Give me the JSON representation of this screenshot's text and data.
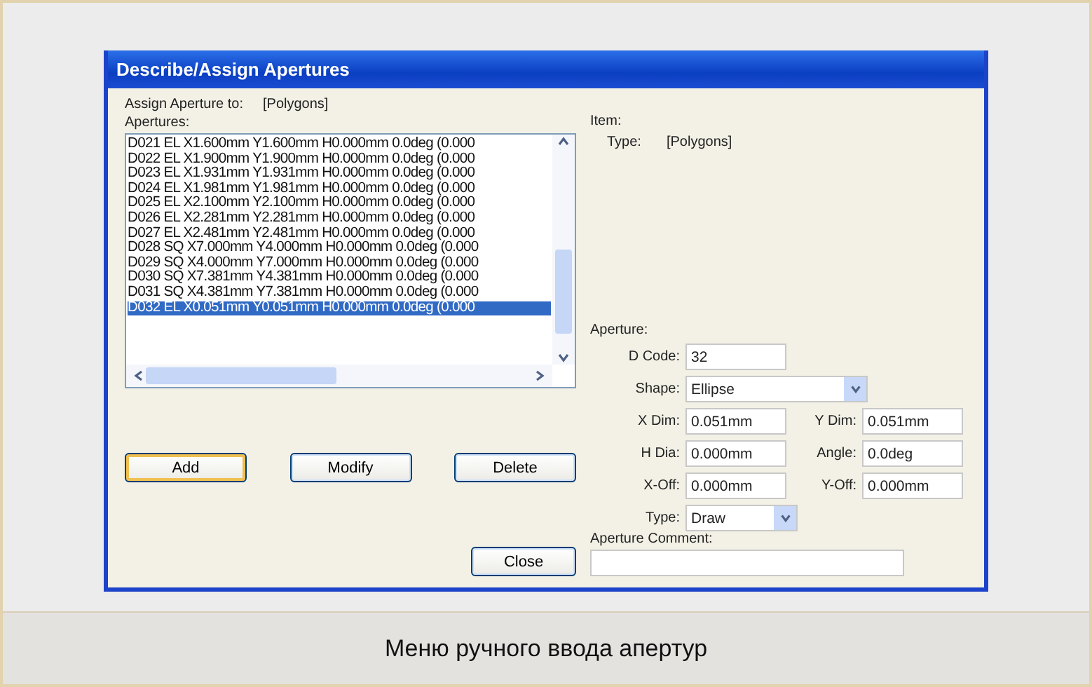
{
  "window": {
    "title": "Describe/Assign Apertures"
  },
  "assign": {
    "label": "Assign Aperture to:",
    "value": "[Polygons]"
  },
  "apertures": {
    "label": "Apertures:",
    "items": [
      {
        "text": "D021 EL X1.600mm Y1.600mm H0.000mm 0.0deg (0.000",
        "selected": false
      },
      {
        "text": "D022 EL X1.900mm Y1.900mm H0.000mm 0.0deg (0.000",
        "selected": false
      },
      {
        "text": "D023 EL X1.931mm Y1.931mm H0.000mm 0.0deg (0.000",
        "selected": false
      },
      {
        "text": "D024 EL X1.981mm Y1.981mm H0.000mm 0.0deg (0.000",
        "selected": false
      },
      {
        "text": "D025 EL X2.100mm Y2.100mm H0.000mm 0.0deg (0.000",
        "selected": false
      },
      {
        "text": "D026 EL X2.281mm Y2.281mm H0.000mm 0.0deg (0.000",
        "selected": false
      },
      {
        "text": "D027 EL X2.481mm Y2.481mm H0.000mm 0.0deg (0.000",
        "selected": false
      },
      {
        "text": "D028 SQ X7.000mm Y4.000mm H0.000mm 0.0deg (0.000",
        "selected": false
      },
      {
        "text": "D029 SQ X4.000mm Y7.000mm H0.000mm 0.0deg (0.000",
        "selected": false
      },
      {
        "text": "D030 SQ X7.381mm Y4.381mm H0.000mm 0.0deg (0.000",
        "selected": false
      },
      {
        "text": "D031 SQ X4.381mm Y7.381mm H0.000mm 0.0deg (0.000",
        "selected": false
      },
      {
        "text": "D032 EL X0.051mm Y0.051mm H0.000mm 0.0deg (0.000",
        "selected": true
      }
    ]
  },
  "buttons": [
    {
      "label": "Add",
      "default": true
    },
    {
      "label": "Modify",
      "default": false
    },
    {
      "label": "Delete",
      "default": false
    }
  ],
  "close_button": {
    "label": "Close"
  },
  "item": {
    "label": "Item:",
    "type_label": "Type:",
    "type_value": "[Polygons]"
  },
  "aperture": {
    "label": "Aperture:",
    "d_code": {
      "label": "D Code:",
      "value": "32"
    },
    "shape": {
      "label": "Shape:",
      "value": "Ellipse"
    },
    "x_dim": {
      "label": "X Dim:",
      "value": "0.051mm"
    },
    "y_dim": {
      "label": "Y Dim:",
      "value": "0.051mm"
    },
    "h_dia": {
      "label": "H Dia:",
      "value": "0.000mm"
    },
    "angle": {
      "label": "Angle:",
      "value": "0.0deg"
    },
    "x_off": {
      "label": "X-Off:",
      "value": "0.000mm"
    },
    "y_off": {
      "label": "Y-Off:",
      "value": "0.000mm"
    },
    "type": {
      "label": "Type:",
      "value": "Draw"
    },
    "comment": {
      "label": "Aperture Comment:"
    }
  },
  "caption": "Меню ручного ввода апертур"
}
